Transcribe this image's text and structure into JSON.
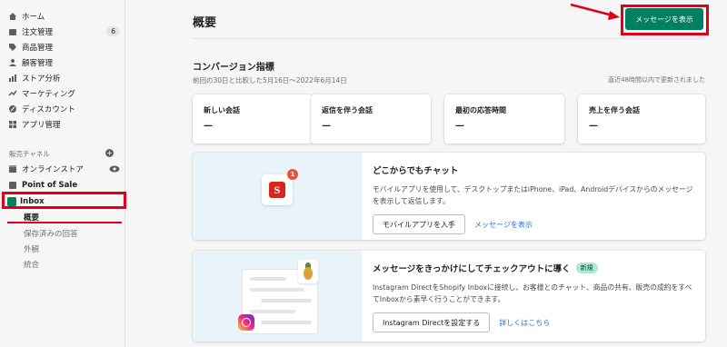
{
  "sidebar": {
    "items": [
      {
        "label": "ホーム",
        "icon": "home-icon"
      },
      {
        "label": "注文管理",
        "icon": "orders-icon",
        "count": "6"
      },
      {
        "label": "商品管理",
        "icon": "tag-icon"
      },
      {
        "label": "顧客管理",
        "icon": "person-icon"
      },
      {
        "label": "ストア分析",
        "icon": "analytics-icon"
      },
      {
        "label": "マーケティング",
        "icon": "marketing-icon"
      },
      {
        "label": "ディスカウント",
        "icon": "discount-icon"
      },
      {
        "label": "アプリ管理",
        "icon": "apps-icon"
      }
    ],
    "sales_channels_title": "販売チャネル",
    "channels": [
      {
        "label": "オンラインストア",
        "icon": "store-icon"
      },
      {
        "label": "Point of Sale",
        "icon": "pos-icon"
      },
      {
        "label": "Inbox",
        "icon": "inbox-icon"
      }
    ],
    "inbox_sub": [
      "概要",
      "保存済みの回答",
      "外観",
      "統合"
    ]
  },
  "header": {
    "title": "概要",
    "primary_button": "メッセージを表示"
  },
  "conversion": {
    "title": "コンバージョン指標",
    "subtitle": "前回の30日と比較した5月16日〜2022年6月14日",
    "note": "直近48時間以内で更新されました",
    "metrics": [
      {
        "label": "新しい会話",
        "value": "—"
      },
      {
        "label": "返信を伴う会話",
        "value": "—"
      },
      {
        "label": "最初の応答時間",
        "value": "—"
      },
      {
        "label": "売上を伴う会話",
        "value": "—"
      }
    ]
  },
  "card_chat": {
    "title": "どこからでもチャット",
    "body": "モバイルアプリを使用して、デスクトップまたはiPhone、iPad、Androidデバイスからのメッセージを表示して返信します。",
    "button": "モバイルアプリを入手",
    "link": "メッセージを表示",
    "notif_count": "1",
    "app_letter": "S"
  },
  "card_checkout": {
    "title": "メッセージをきっかけにしてチェックアウトに導く",
    "badge": "新規",
    "body": "Instagram DirectをShopify Inboxに接続し、お客様とのチャット、商品の共有、販売の成約をすべてInboxから素早く行うことができます。",
    "button": "Instagram Directを設定する",
    "link": "詳しくはこちら"
  },
  "colors": {
    "accent": "#008060",
    "highlight": "#e10016",
    "link": "#2c6ecb"
  }
}
